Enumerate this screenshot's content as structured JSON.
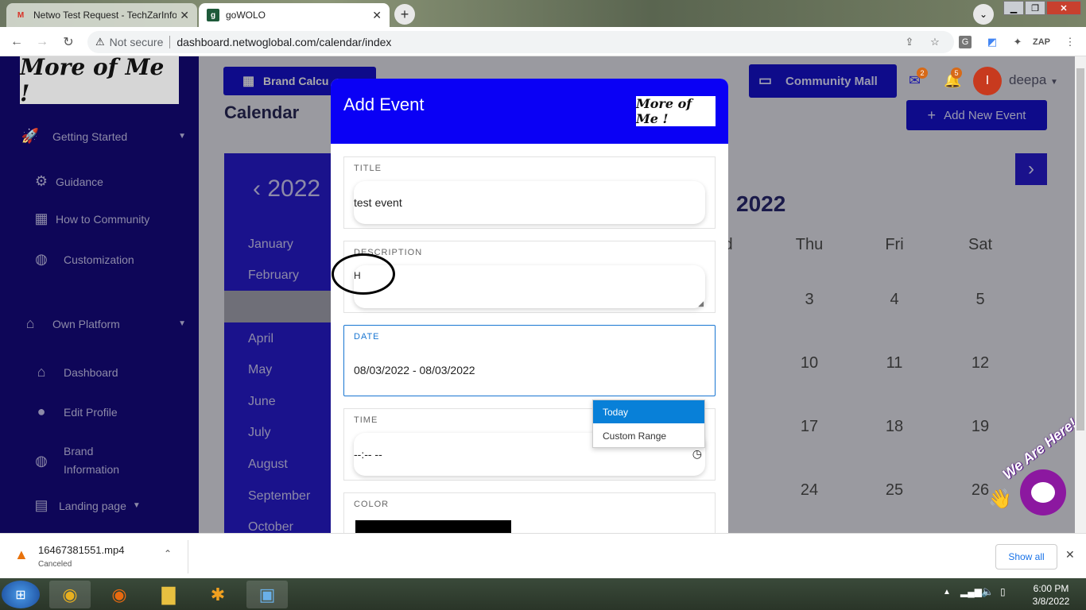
{
  "browser": {
    "tabs": [
      {
        "title": "Netwo Test Request - TechZarInfo",
        "icon": "gmail-icon"
      },
      {
        "title": "goWOLO",
        "icon": "gowolo-icon"
      }
    ],
    "security_label": "Not secure",
    "url": "dashboard.netwoglobal.com/calendar/index"
  },
  "sidebar": {
    "logo": "More of Me !",
    "items": [
      {
        "label": "Getting Started",
        "icon": "rocket-icon"
      },
      {
        "label": "Guidance",
        "icon": "guidance-icon"
      },
      {
        "label": "How to Community",
        "icon": "community-icon"
      },
      {
        "label": "Customization",
        "icon": "globe-icon"
      },
      {
        "label": "Own Platform",
        "icon": "home-icon"
      },
      {
        "label": "Dashboard",
        "icon": "home-icon"
      },
      {
        "label": "Edit Profile",
        "icon": "user-icon"
      },
      {
        "label": "Brand Information",
        "icon": "globe-icon"
      },
      {
        "label": "Landing page",
        "icon": "landing-icon"
      }
    ]
  },
  "header": {
    "brand_calc": "Brand Calcu",
    "community_mall": "Community Mall",
    "add_new_event": "Add New Event",
    "mail_badge": "2",
    "bell_badge": "5",
    "avatar_letter": "I",
    "username": "deepa"
  },
  "calendar": {
    "title": "Calendar",
    "year_left": "2022",
    "year_right": "2022",
    "months": [
      "January",
      "February",
      "April",
      "May",
      "June",
      "July",
      "August",
      "September",
      "October"
    ],
    "day_headers": [
      "d",
      "Thu",
      "Fri",
      "Sat"
    ],
    "weeks": [
      [
        "3",
        "4",
        "5"
      ],
      [
        "10",
        "11",
        "12"
      ],
      [
        "17",
        "18",
        "19"
      ],
      [
        "24",
        "25",
        "26"
      ]
    ]
  },
  "modal": {
    "title": "Add Event",
    "logo": "More of Me !",
    "title_label": "TITLE",
    "title_value": "test event",
    "description_label": "DESCRIPTION",
    "description_value": "H",
    "date_label": "DATE",
    "date_value": "08/03/2022 - 08/03/2022",
    "time_label": "TIME",
    "time_value": "--:-- --",
    "color_label": "COLOR",
    "color_value": "#000000"
  },
  "date_dropdown": {
    "options": [
      "Today",
      "Custom Range"
    ],
    "selected": "Today"
  },
  "chat_widget": {
    "label": "We Are Here!"
  },
  "downloads": {
    "file": "16467381551.mp4",
    "status": "Canceled",
    "show_all": "Show all"
  },
  "taskbar": {
    "time": "6:00 PM",
    "date": "3/8/2022"
  },
  "colors": {
    "sidebar_bg": "#0e0658",
    "modal_header": "#0a00f5",
    "accent": "#1976d2",
    "dropdown_selected": "#0880d8",
    "chat_button": "#8c18a0"
  }
}
